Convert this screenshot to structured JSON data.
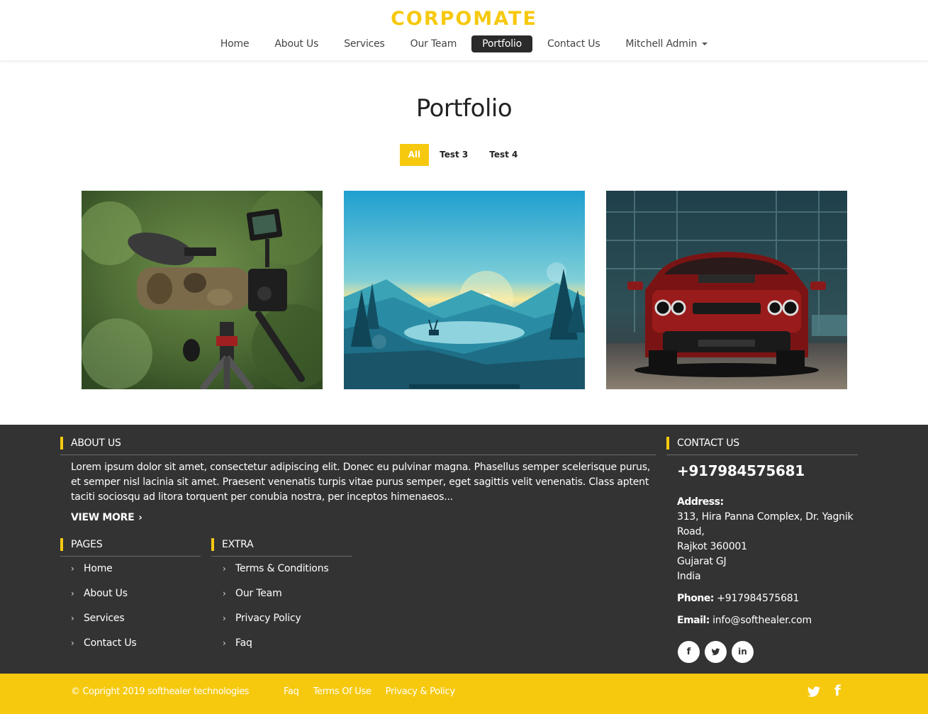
{
  "brand": {
    "logo": "CORPOMATE",
    "accent": "#f6c90e",
    "footer_bg": "#333333"
  },
  "nav": {
    "items": [
      {
        "label": "Home"
      },
      {
        "label": "About Us"
      },
      {
        "label": "Services"
      },
      {
        "label": "Our Team"
      },
      {
        "label": "Portfolio",
        "active": true
      },
      {
        "label": "Contact Us"
      },
      {
        "label": "Mitchell Admin",
        "dropdown": true
      }
    ]
  },
  "portfolio": {
    "title": "Portfolio",
    "filters": [
      {
        "label": "All",
        "active": true
      },
      {
        "label": "Test 3"
      },
      {
        "label": "Test 4"
      }
    ],
    "images": [
      {
        "subject": "video camera on tripod in forest"
      },
      {
        "subject": "flat illustration mountain lake with deer at sunrise"
      },
      {
        "subject": "red muscle car front view"
      }
    ]
  },
  "footer": {
    "about": {
      "title": "ABOUT US",
      "text": "Lorem ipsum dolor sit amet, consectetur adipiscing elit. Donec eu pulvinar magna. Phasellus semper scelerisque purus, et semper nisl lacinia sit amet. Praesent venenatis turpis vitae purus semper, eget sagittis velit venenatis. Class aptent taciti sociosqu ad litora torquent per conubia nostra, per inceptos himenaeos...",
      "view_more": "VIEW MORE"
    },
    "pages": {
      "title": "PAGES",
      "links": [
        "Home",
        "About Us",
        "Services",
        "Contact Us"
      ]
    },
    "extra": {
      "title": "EXTRA",
      "links": [
        "Terms & Conditions",
        "Our Team",
        "Privacy Policy",
        "Faq"
      ]
    },
    "contact": {
      "title": "CONTACT US",
      "phone_big": "+917984575681",
      "address_label": "Address:",
      "address_lines": [
        "313, Hira Panna Complex, Dr. Yagnik Road,",
        "Rajkot 360001",
        "Gujarat GJ",
        "India"
      ],
      "phone_label": "Phone:",
      "phone": "+917984575681",
      "email_label": "Email:",
      "email": "info@softhealer.com",
      "socials": [
        {
          "icon": "facebook-icon",
          "glyph": "f"
        },
        {
          "icon": "twitter-icon",
          "glyph": "t"
        },
        {
          "icon": "linkedin-icon",
          "glyph": "in"
        }
      ]
    }
  },
  "bottom": {
    "copyright": "© Copright 2019 softhealer technologies",
    "links": [
      "Faq",
      "Terms Of Use",
      "Privacy & Policy"
    ],
    "socials": [
      {
        "icon": "twitter-icon"
      },
      {
        "icon": "facebook-icon",
        "glyph": "f"
      }
    ]
  }
}
